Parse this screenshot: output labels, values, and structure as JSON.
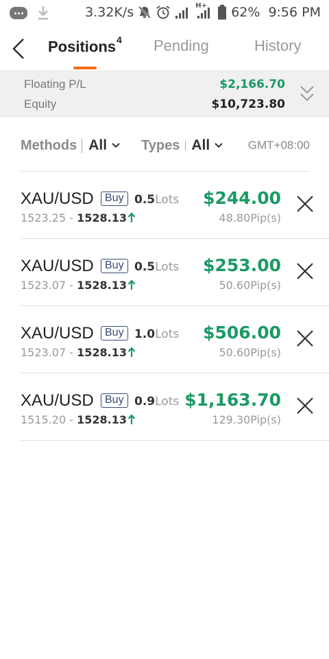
{
  "status_bar": {
    "speed": "3.32K/s",
    "network": "H+",
    "battery": "62%",
    "time": "9:56 PM"
  },
  "tabs": [
    {
      "label": "Positions",
      "badge": "4",
      "active": true
    },
    {
      "label": "Pending",
      "active": false
    },
    {
      "label": "History",
      "active": false
    }
  ],
  "summary": {
    "floating_label": "Floating P/L",
    "floating_value": "$2,166.70",
    "equity_label": "Equity",
    "equity_value": "$10,723.80"
  },
  "filters": {
    "methods_label": "Methods",
    "methods_value": "All",
    "types_label": "Types",
    "types_value": "All",
    "timezone": "GMT+08:00"
  },
  "positions": [
    {
      "symbol": "XAU/USD",
      "side": "Buy",
      "lots": "0.5",
      "lots_unit": "Lots",
      "open_price": "1523.25",
      "current_price": "1528.13",
      "pl": "$244.00",
      "pips": "48.80Pip(s)"
    },
    {
      "symbol": "XAU/USD",
      "side": "Buy",
      "lots": "0.5",
      "lots_unit": "Lots",
      "open_price": "1523.07",
      "current_price": "1528.13",
      "pl": "$253.00",
      "pips": "50.60Pip(s)"
    },
    {
      "symbol": "XAU/USD",
      "side": "Buy",
      "lots": "1.0",
      "lots_unit": "Lots",
      "open_price": "1523.07",
      "current_price": "1528.13",
      "pl": "$506.00",
      "pips": "50.60Pip(s)"
    },
    {
      "symbol": "XAU/USD",
      "side": "Buy",
      "lots": "0.9",
      "lots_unit": "Lots",
      "open_price": "1515.20",
      "current_price": "1528.13",
      "pl": "$1,163.70",
      "pips": "129.30Pip(s)"
    }
  ],
  "colors": {
    "accent": "#f26a1b",
    "profit": "#1a9a64",
    "summary_bg": "#f0f0f0"
  }
}
